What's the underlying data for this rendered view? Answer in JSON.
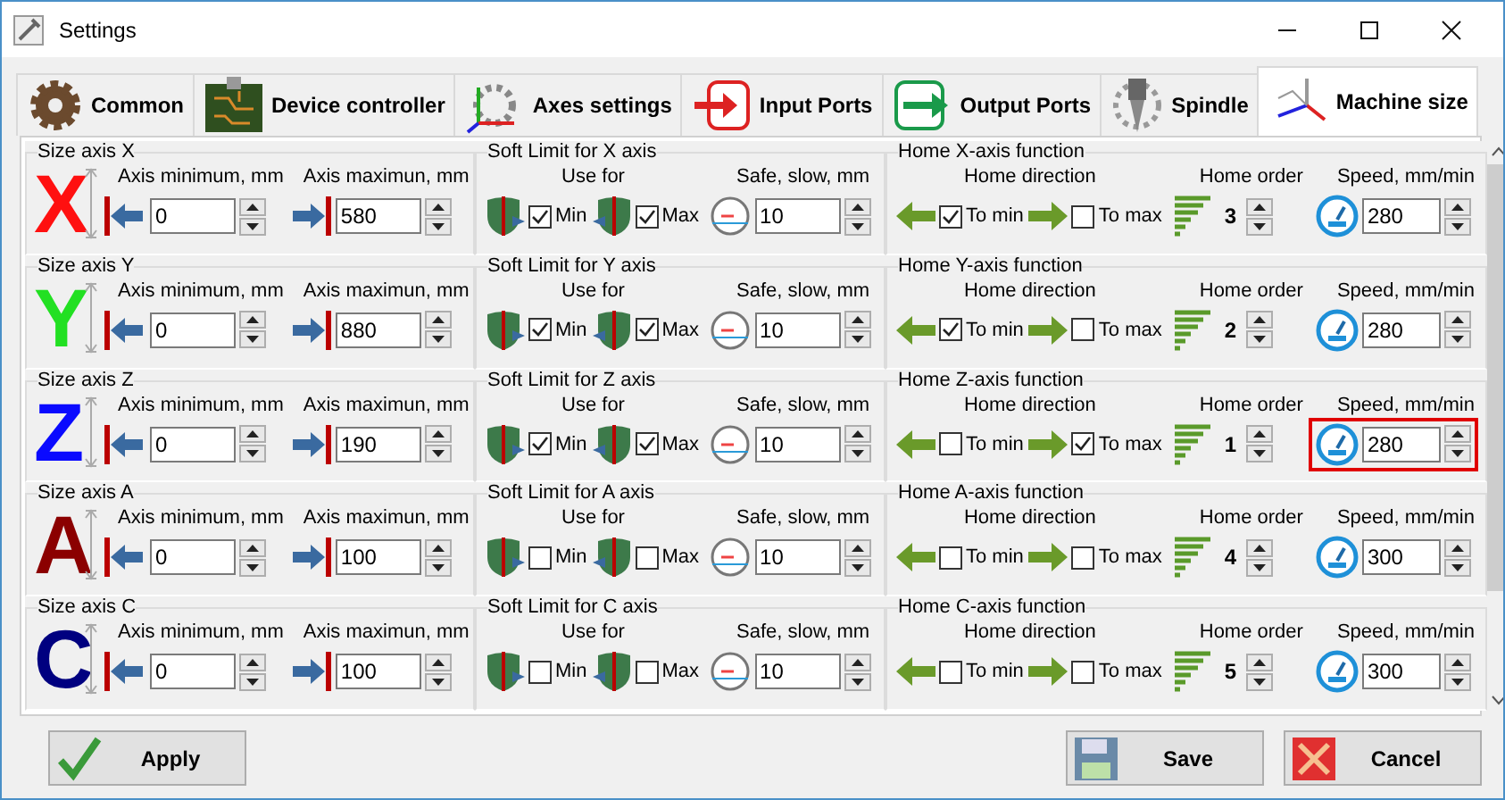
{
  "window": {
    "title": "Settings"
  },
  "tabs": [
    {
      "label": "Common",
      "selected": false
    },
    {
      "label": "Device controller",
      "selected": false
    },
    {
      "label": "Axes settings",
      "selected": false
    },
    {
      "label": "Input Ports",
      "selected": false
    },
    {
      "label": "Output Ports",
      "selected": false
    },
    {
      "label": "Spindle",
      "selected": false
    },
    {
      "label": "Machine size",
      "selected": true
    }
  ],
  "axes": [
    {
      "size_title": "Size axis X",
      "letter": "X",
      "color": "#ff1010",
      "min_label": "Axis minimum, mm",
      "min_value": "0",
      "max_label": "Axis maximun, mm",
      "max_value": "580",
      "soft_title": "Soft Limit for X axis",
      "use_for_label": "Use for",
      "soft_min_label": "Min",
      "soft_min_checked": true,
      "soft_max_label": "Max",
      "soft_max_checked": true,
      "safe_label": "Safe, slow, mm",
      "safe_value": "10",
      "home_title": "Home X-axis function",
      "direction_label": "Home direction",
      "to_min_label": "To min",
      "to_min_checked": true,
      "to_max_label": "To max",
      "to_max_checked": false,
      "order_label": "Home order",
      "order": "3",
      "speed_label": "Speed, mm/min",
      "speed": "280",
      "highlighted": false
    },
    {
      "size_title": "Size axis Y",
      "letter": "Y",
      "color": "#22e022",
      "min_label": "Axis minimum, mm",
      "min_value": "0",
      "max_label": "Axis maximun, mm",
      "max_value": "880",
      "soft_title": "Soft Limit for Y axis",
      "use_for_label": "Use for",
      "soft_min_label": "Min",
      "soft_min_checked": true,
      "soft_max_label": "Max",
      "soft_max_checked": true,
      "safe_label": "Safe, slow, mm",
      "safe_value": "10",
      "home_title": "Home Y-axis function",
      "direction_label": "Home direction",
      "to_min_label": "To min",
      "to_min_checked": true,
      "to_max_label": "To max",
      "to_max_checked": false,
      "order_label": "Home order",
      "order": "2",
      "speed_label": "Speed, mm/min",
      "speed": "280",
      "highlighted": false
    },
    {
      "size_title": "Size axis Z",
      "letter": "Z",
      "color": "#0a0aff",
      "min_label": "Axis minimum, mm",
      "min_value": "0",
      "max_label": "Axis maximun, mm",
      "max_value": "190",
      "soft_title": "Soft Limit for Z axis",
      "use_for_label": "Use for",
      "soft_min_label": "Min",
      "soft_min_checked": true,
      "soft_max_label": "Max",
      "soft_max_checked": true,
      "safe_label": "Safe, slow, mm",
      "safe_value": "10",
      "home_title": "Home Z-axis function",
      "direction_label": "Home direction",
      "to_min_label": "To min",
      "to_min_checked": false,
      "to_max_label": "To max",
      "to_max_checked": true,
      "order_label": "Home order",
      "order": "1",
      "speed_label": "Speed, mm/min",
      "speed": "280",
      "highlighted": true
    },
    {
      "size_title": "Size axis A",
      "letter": "A",
      "color": "#8b0000",
      "min_label": "Axis minimum, mm",
      "min_value": "0",
      "max_label": "Axis maximun, mm",
      "max_value": "100",
      "soft_title": "Soft Limit for A axis",
      "use_for_label": "Use for",
      "soft_min_label": "Min",
      "soft_min_checked": false,
      "soft_max_label": "Max",
      "soft_max_checked": false,
      "safe_label": "Safe, slow, mm",
      "safe_value": "10",
      "home_title": "Home A-axis function",
      "direction_label": "Home direction",
      "to_min_label": "To min",
      "to_min_checked": false,
      "to_max_label": "To max",
      "to_max_checked": false,
      "order_label": "Home order",
      "order": "4",
      "speed_label": "Speed, mm/min",
      "speed": "300",
      "highlighted": false
    },
    {
      "size_title": "Size axis C",
      "letter": "C",
      "color": "#000080",
      "min_label": "Axis minimum, mm",
      "min_value": "0",
      "max_label": "Axis maximun, mm",
      "max_value": "100",
      "soft_title": "Soft Limit for C axis",
      "use_for_label": "Use for",
      "soft_min_label": "Min",
      "soft_min_checked": false,
      "soft_max_label": "Max",
      "soft_max_checked": false,
      "safe_label": "Safe, slow, mm",
      "safe_value": "10",
      "home_title": "Home C-axis function",
      "direction_label": "Home direction",
      "to_min_label": "To min",
      "to_min_checked": false,
      "to_max_label": "To max",
      "to_max_checked": false,
      "order_label": "Home order",
      "order": "5",
      "speed_label": "Speed, mm/min",
      "speed": "300",
      "highlighted": false
    }
  ],
  "buttons": [
    {
      "label": "Apply",
      "kind": "apply"
    },
    {
      "label": "Save",
      "kind": "save"
    },
    {
      "label": "Cancel",
      "kind": "cancel"
    }
  ]
}
